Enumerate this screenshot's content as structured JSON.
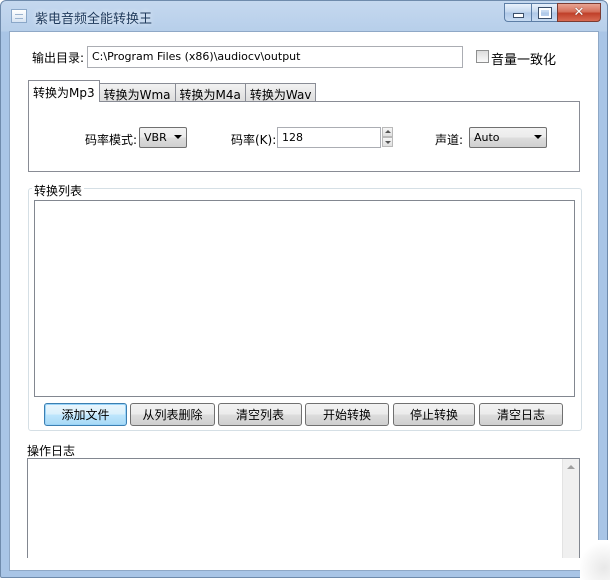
{
  "window": {
    "title": "紫电音频全能转换王",
    "controls": {
      "minimize": "−",
      "maximize": "□",
      "close": "✕"
    }
  },
  "output": {
    "label": "输出目录:",
    "path": "C:\\Program Files (x86)\\audiocv\\output",
    "volume_label": "音量一致化",
    "volume_checked": false
  },
  "tabs": [
    {
      "label": "转换为Mp3",
      "active": true
    },
    {
      "label": "转换为Wma",
      "active": false
    },
    {
      "label": "转换为M4a",
      "active": false
    },
    {
      "label": "转换为Wav",
      "active": false
    }
  ],
  "settings": {
    "mode_label": "码率模式:",
    "mode_value": "VBR",
    "bitrate_label": "码率(K):",
    "bitrate_value": "128",
    "channel_label": "声道:",
    "channel_value": "Auto"
  },
  "convert_list": {
    "label": "转换列表",
    "items": []
  },
  "buttons": {
    "add_file": "添加文件",
    "remove_from_list": "从列表删除",
    "clear_list": "清空列表",
    "start": "开始转换",
    "stop": "停止转换",
    "clear_log": "清空日志"
  },
  "log": {
    "label": "操作日志",
    "content": ""
  },
  "icons": {
    "app": "app-window-icon",
    "dropdown": "chevron-down-icon"
  }
}
